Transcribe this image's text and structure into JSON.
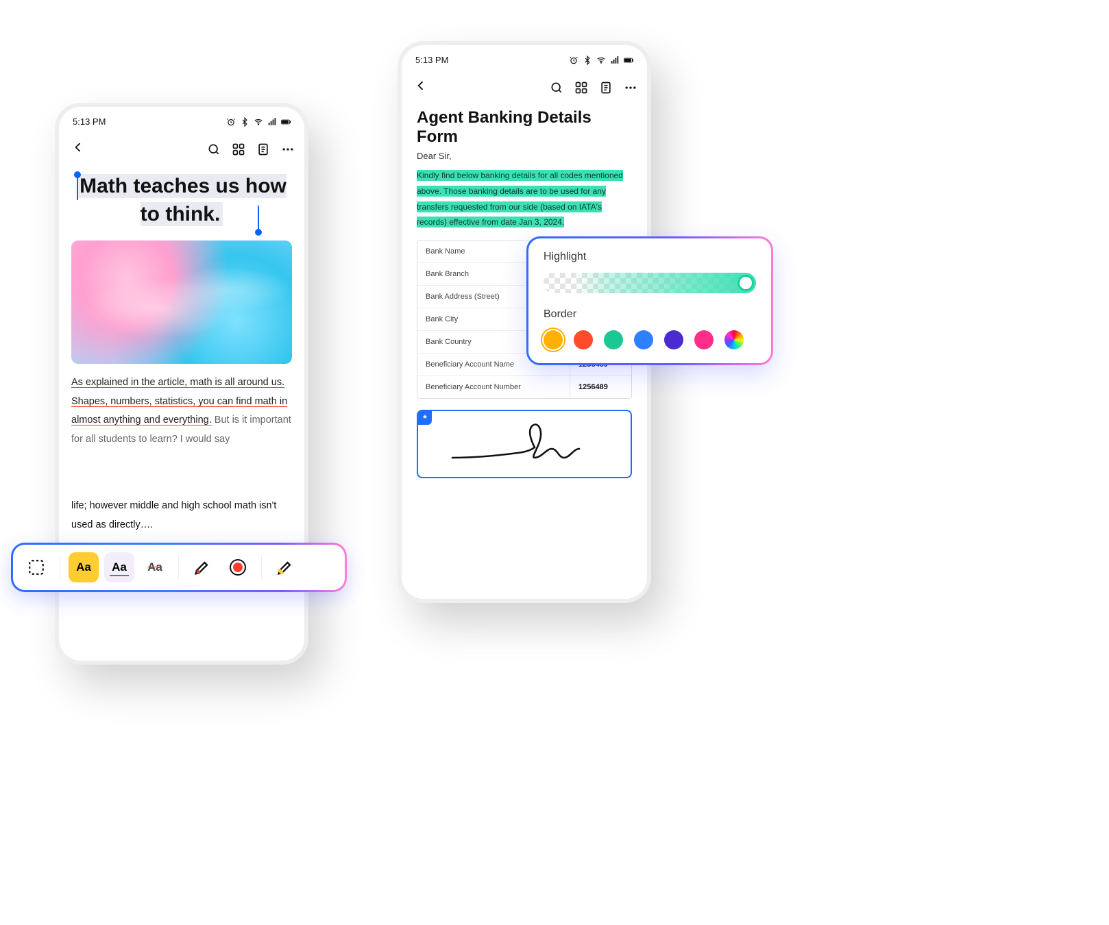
{
  "status": {
    "time": "5:13 PM"
  },
  "left": {
    "heading": "Math teaches us how to think.",
    "article_underlined": "As explained in the article, math is all around us. Shapes, numbers, statistics, you can find math in almost anything and everything.",
    "article_tail_a": " But is it important for all students to learn? I would say",
    "article_tail_b": "life; however middle and high school math isn't used as directly….",
    "format_text_aa": "Aa"
  },
  "right": {
    "title": "Agent Banking Details Form",
    "greeting": "Dear Sir,",
    "highlighted": "Kindly find below banking details for all codes mentioned above. Those banking details are to be used for any transfers requested from our side (based on IATA's records) effective from date Jan 3, 2024.",
    "rows": [
      {
        "label": "Bank Name",
        "value": ""
      },
      {
        "label": "Bank Branch",
        "value": ""
      },
      {
        "label": "Bank Address (Street)",
        "value": ""
      },
      {
        "label": "Bank City",
        "value": ""
      },
      {
        "label": "Bank Country",
        "value": ""
      },
      {
        "label": "Beneficiary Account Name",
        "value": "1256489"
      },
      {
        "label": "Beneficiary Account Number",
        "value": "1256489"
      }
    ]
  },
  "hl_panel": {
    "highlight_label": "Highlight",
    "border_label": "Border",
    "colors": [
      "#ffb000",
      "#ff4b2b",
      "#1bc793",
      "#2f80ff",
      "#4b2bd1",
      "#ff2e8a"
    ]
  }
}
